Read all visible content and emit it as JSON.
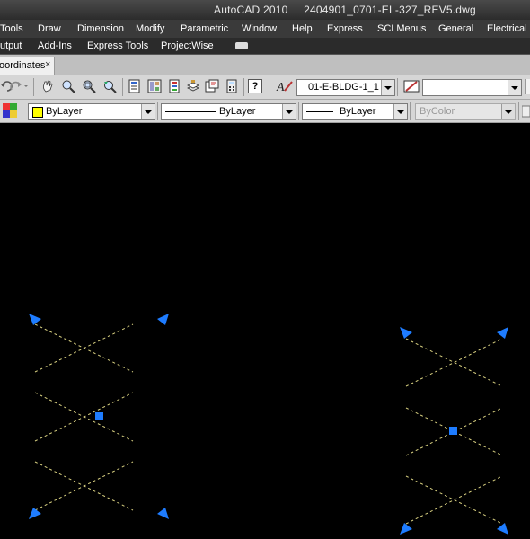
{
  "window": {
    "title": "AutoCAD 2010     2404901_0701-EL-327_REV5.dwg"
  },
  "menu": [
    "Tools",
    "Draw",
    "Dimension",
    "Modify",
    "Parametric",
    "Window",
    "Help",
    "Express",
    "SCI Menus",
    "General",
    "Electrical S"
  ],
  "ribbon_tabs": [
    "utput",
    "Add-Ins",
    "Express Tools",
    "ProjectWise"
  ],
  "file_tab": {
    "label": "oordinates",
    "close": "×"
  },
  "toolbar": {
    "dimstyle": "01-E-BLDG-1_1",
    "help_glyph": "?",
    "empty_combo": ""
  },
  "properties": {
    "color": "ByLayer",
    "linetype": "ByLayer",
    "lineweight": "ByLayer",
    "plotstyle": "ByColor"
  },
  "colors": {
    "grip": "#1e7cff",
    "crossing_lines": "#d8d080",
    "bylayer_swatch": "#ffff00"
  }
}
